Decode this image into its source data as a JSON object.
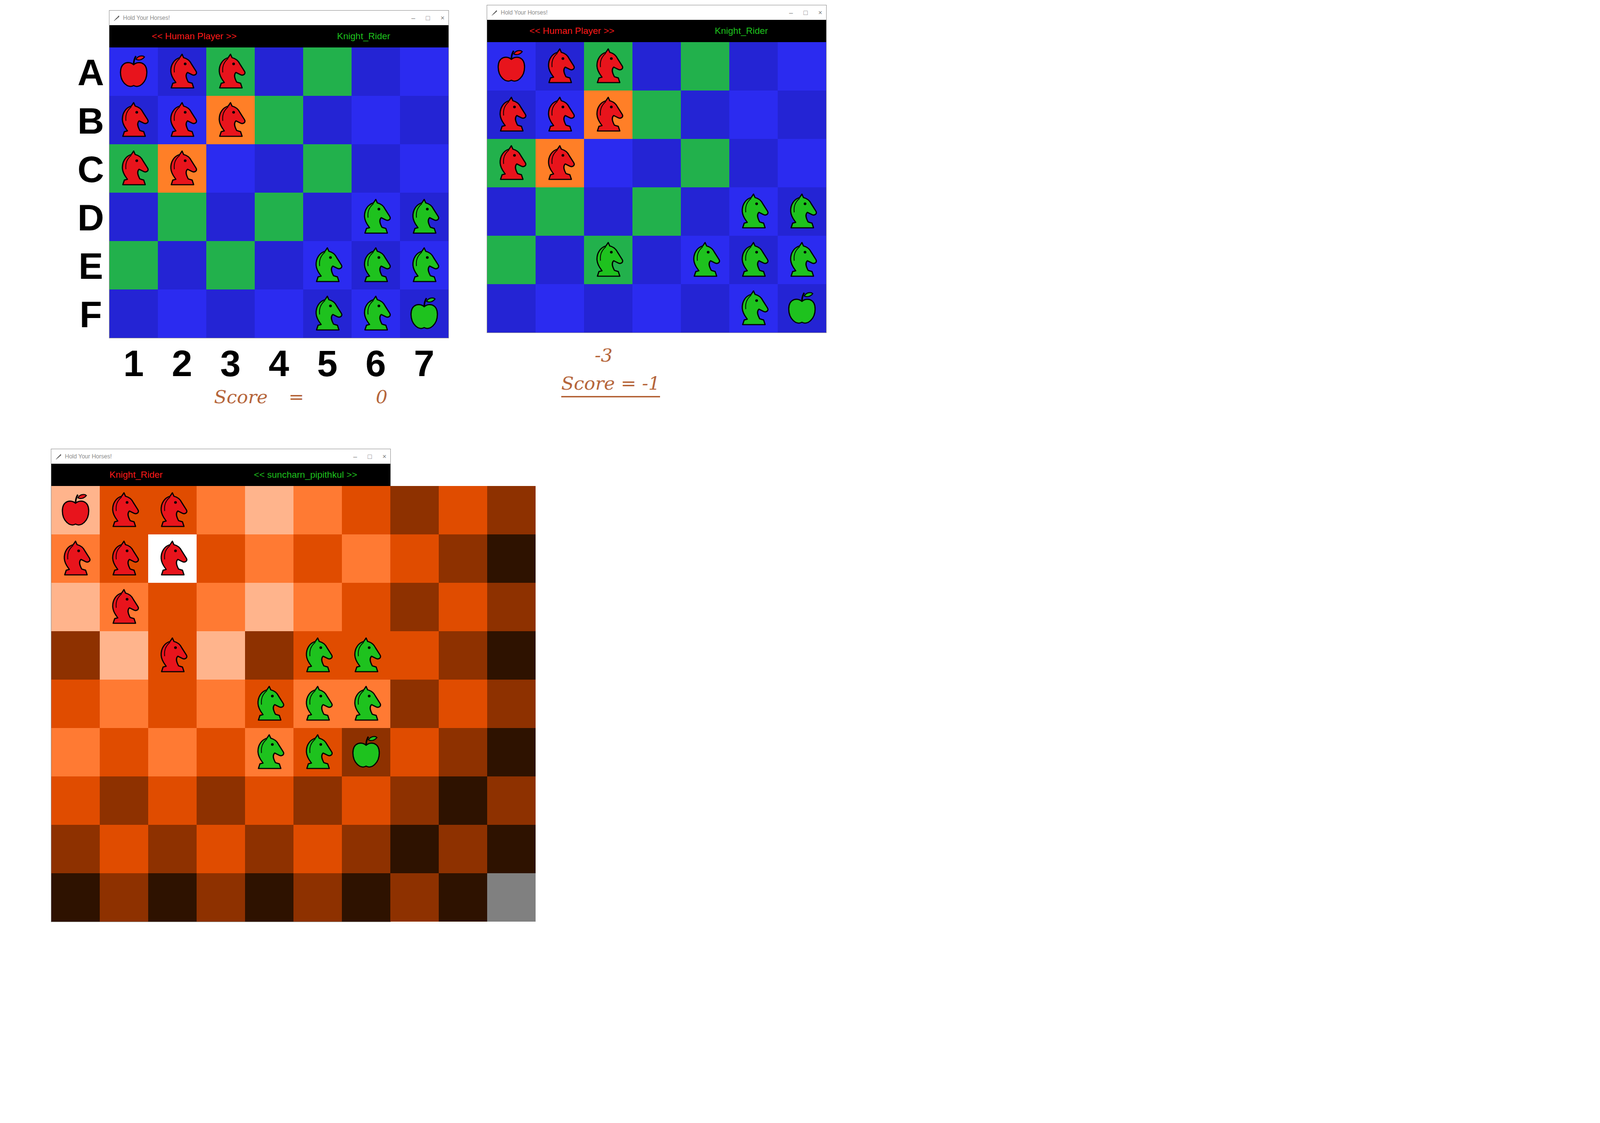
{
  "windows": [
    {
      "title": "Hold Your Horses!",
      "controls": [
        "–",
        "□",
        "×"
      ],
      "players": [
        {
          "name": "<< Human Player >>",
          "color": "#ff1a1a"
        },
        {
          "name": "Knight_Rider",
          "color": "#1ec21e"
        }
      ],
      "row_labels": [
        "A",
        "B",
        "C",
        "D",
        "E",
        "F"
      ],
      "col_labels": [
        "1",
        "2",
        "3",
        "4",
        "5",
        "6",
        "7"
      ],
      "board": [
        [
          {
            "color": "#2b2bf0",
            "kind": "apple",
            "side": "red"
          },
          {
            "color": "#2424d4",
            "kind": "knight",
            "side": "red"
          },
          {
            "color": "#22b14c",
            "kind": "knight",
            "side": "red"
          },
          {
            "color": "#2424d4",
            "kind": "empty"
          },
          {
            "color": "#22b14c",
            "kind": "empty"
          },
          {
            "color": "#2424d4",
            "kind": "empty"
          },
          {
            "color": "#2b2bf0",
            "kind": "empty"
          }
        ],
        [
          {
            "color": "#2424d4",
            "kind": "knight",
            "side": "red"
          },
          {
            "color": "#2b2bf0",
            "kind": "knight",
            "side": "red"
          },
          {
            "color": "#ff7f27",
            "kind": "knight",
            "side": "red"
          },
          {
            "color": "#22b14c",
            "kind": "empty"
          },
          {
            "color": "#2424d4",
            "kind": "empty"
          },
          {
            "color": "#2b2bf0",
            "kind": "empty"
          },
          {
            "color": "#2424d4",
            "kind": "empty"
          }
        ],
        [
          {
            "color": "#22b14c",
            "kind": "knight",
            "side": "red"
          },
          {
            "color": "#ff7f27",
            "kind": "knight",
            "side": "red"
          },
          {
            "color": "#2b2bf0",
            "kind": "empty"
          },
          {
            "color": "#2424d4",
            "kind": "empty"
          },
          {
            "color": "#22b14c",
            "kind": "empty"
          },
          {
            "color": "#2424d4",
            "kind": "empty"
          },
          {
            "color": "#2b2bf0",
            "kind": "empty"
          }
        ],
        [
          {
            "color": "#2424d4",
            "kind": "empty"
          },
          {
            "color": "#22b14c",
            "kind": "empty"
          },
          {
            "color": "#2424d4",
            "kind": "empty"
          },
          {
            "color": "#22b14c",
            "kind": "empty"
          },
          {
            "color": "#2424d4",
            "kind": "empty"
          },
          {
            "color": "#2b2bf0",
            "kind": "knight",
            "side": "green"
          },
          {
            "color": "#2424d4",
            "kind": "knight",
            "side": "green"
          }
        ],
        [
          {
            "color": "#22b14c",
            "kind": "empty"
          },
          {
            "color": "#2424d4",
            "kind": "empty"
          },
          {
            "color": "#22b14c",
            "kind": "empty"
          },
          {
            "color": "#2424d4",
            "kind": "empty"
          },
          {
            "color": "#2b2bf0",
            "kind": "knight",
            "side": "green"
          },
          {
            "color": "#2424d4",
            "kind": "knight",
            "side": "green"
          },
          {
            "color": "#2b2bf0",
            "kind": "knight",
            "side": "green"
          }
        ],
        [
          {
            "color": "#2424d4",
            "kind": "empty"
          },
          {
            "color": "#2b2bf0",
            "kind": "empty"
          },
          {
            "color": "#2424d4",
            "kind": "empty"
          },
          {
            "color": "#2b2bf0",
            "kind": "empty"
          },
          {
            "color": "#2424d4",
            "kind": "knight",
            "side": "green"
          },
          {
            "color": "#2b2bf0",
            "kind": "knight",
            "side": "green"
          },
          {
            "color": "#2424d4",
            "kind": "apple",
            "side": "green"
          }
        ]
      ]
    },
    {
      "title": "Hold Your Horses!",
      "controls": [
        "–",
        "□",
        "×"
      ],
      "players": [
        {
          "name": "<< Human Player >>",
          "color": "#ff1a1a"
        },
        {
          "name": "Knight_Rider",
          "color": "#1ec21e"
        }
      ],
      "board": [
        [
          {
            "color": "#2b2bf0",
            "kind": "apple",
            "side": "red"
          },
          {
            "color": "#2424d4",
            "kind": "knight",
            "side": "red"
          },
          {
            "color": "#22b14c",
            "kind": "knight",
            "side": "red"
          },
          {
            "color": "#2424d4",
            "kind": "empty"
          },
          {
            "color": "#22b14c",
            "kind": "empty"
          },
          {
            "color": "#2424d4",
            "kind": "empty"
          },
          {
            "color": "#2b2bf0",
            "kind": "empty"
          }
        ],
        [
          {
            "color": "#2424d4",
            "kind": "knight",
            "side": "red"
          },
          {
            "color": "#2b2bf0",
            "kind": "knight",
            "side": "red"
          },
          {
            "color": "#ff7f27",
            "kind": "knight",
            "side": "red"
          },
          {
            "color": "#22b14c",
            "kind": "empty"
          },
          {
            "color": "#2424d4",
            "kind": "empty"
          },
          {
            "color": "#2b2bf0",
            "kind": "empty"
          },
          {
            "color": "#2424d4",
            "kind": "empty"
          }
        ],
        [
          {
            "color": "#22b14c",
            "kind": "knight",
            "side": "red"
          },
          {
            "color": "#ff7f27",
            "kind": "knight",
            "side": "red"
          },
          {
            "color": "#2b2bf0",
            "kind": "empty"
          },
          {
            "color": "#2424d4",
            "kind": "empty"
          },
          {
            "color": "#22b14c",
            "kind": "empty"
          },
          {
            "color": "#2424d4",
            "kind": "empty"
          },
          {
            "color": "#2b2bf0",
            "kind": "empty"
          }
        ],
        [
          {
            "color": "#2424d4",
            "kind": "empty"
          },
          {
            "color": "#22b14c",
            "kind": "empty"
          },
          {
            "color": "#2424d4",
            "kind": "empty"
          },
          {
            "color": "#22b14c",
            "kind": "empty"
          },
          {
            "color": "#2424d4",
            "kind": "empty"
          },
          {
            "color": "#2b2bf0",
            "kind": "knight",
            "side": "green"
          },
          {
            "color": "#2424d4",
            "kind": "knight",
            "side": "green"
          }
        ],
        [
          {
            "color": "#22b14c",
            "kind": "empty"
          },
          {
            "color": "#2424d4",
            "kind": "empty"
          },
          {
            "color": "#22b14c",
            "kind": "knight",
            "side": "green"
          },
          {
            "color": "#2424d4",
            "kind": "empty"
          },
          {
            "color": "#2b2bf0",
            "kind": "knight",
            "side": "green"
          },
          {
            "color": "#2424d4",
            "kind": "knight",
            "side": "green"
          },
          {
            "color": "#2b2bf0",
            "kind": "knight",
            "side": "green"
          }
        ],
        [
          {
            "color": "#2424d4",
            "kind": "empty"
          },
          {
            "color": "#2b2bf0",
            "kind": "empty"
          },
          {
            "color": "#2424d4",
            "kind": "empty"
          },
          {
            "color": "#2b2bf0",
            "kind": "empty"
          },
          {
            "color": "#2424d4",
            "kind": "empty"
          },
          {
            "color": "#2b2bf0",
            "kind": "knight",
            "side": "green"
          },
          {
            "color": "#2424d4",
            "kind": "apple",
            "side": "green"
          }
        ]
      ]
    },
    {
      "title": "Hold Your Horses!",
      "controls": [
        "–",
        "□",
        "×"
      ],
      "players": [
        {
          "name": "Knight_Rider",
          "color": "#ff1a1a"
        },
        {
          "name": "<< suncharn_pipithkul >>",
          "color": "#1ec21e"
        }
      ],
      "board": [
        [
          {
            "color": "#ffb48c",
            "kind": "apple",
            "side": "red"
          },
          {
            "color": "#e04c00",
            "kind": "knight",
            "side": "red"
          },
          {
            "color": "#e04c00",
            "kind": "knight",
            "side": "red"
          },
          {
            "color": "#ff7a33",
            "kind": "empty"
          },
          {
            "color": "#ffb48c",
            "kind": "empty"
          },
          {
            "color": "#ff7a33",
            "kind": "empty"
          },
          {
            "color": "#e04c00",
            "kind": "empty"
          },
          {
            "color": "#8e3100",
            "kind": "empty"
          },
          {
            "color": "#e04c00",
            "kind": "empty"
          },
          {
            "color": "#8e3100",
            "kind": "empty"
          }
        ],
        [
          {
            "color": "#ff7a33",
            "kind": "knight",
            "side": "red"
          },
          {
            "color": "#e04c00",
            "kind": "knight",
            "side": "red"
          },
          {
            "color": "#ffffff",
            "kind": "knight",
            "side": "red"
          },
          {
            "color": "#e04c00",
            "kind": "empty"
          },
          {
            "color": "#ff7a33",
            "kind": "empty"
          },
          {
            "color": "#e04c00",
            "kind": "empty"
          },
          {
            "color": "#ff7a33",
            "kind": "empty"
          },
          {
            "color": "#e04c00",
            "kind": "empty"
          },
          {
            "color": "#8e3100",
            "kind": "empty"
          },
          {
            "color": "#2e1200",
            "kind": "empty"
          }
        ],
        [
          {
            "color": "#ffb48c",
            "kind": "empty"
          },
          {
            "color": "#ff7a33",
            "kind": "knight",
            "side": "red"
          },
          {
            "color": "#e04c00",
            "kind": "empty"
          },
          {
            "color": "#ff7a33",
            "kind": "empty"
          },
          {
            "color": "#ffb48c",
            "kind": "empty"
          },
          {
            "color": "#ff7a33",
            "kind": "empty"
          },
          {
            "color": "#e04c00",
            "kind": "empty"
          },
          {
            "color": "#8e3100",
            "kind": "empty"
          },
          {
            "color": "#e04c00",
            "kind": "empty"
          },
          {
            "color": "#8e3100",
            "kind": "empty"
          }
        ],
        [
          {
            "color": "#8e3100",
            "kind": "empty"
          },
          {
            "color": "#ffb48c",
            "kind": "empty"
          },
          {
            "color": "#e04c00",
            "kind": "knight",
            "side": "red"
          },
          {
            "color": "#ffb48c",
            "kind": "empty"
          },
          {
            "color": "#8e3100",
            "kind": "empty"
          },
          {
            "color": "#e04c00",
            "kind": "knight",
            "side": "green"
          },
          {
            "color": "#e04c00",
            "kind": "knight",
            "side": "green"
          },
          {
            "color": "#e04c00",
            "kind": "empty"
          },
          {
            "color": "#8e3100",
            "kind": "empty"
          },
          {
            "color": "#2e1200",
            "kind": "empty"
          }
        ],
        [
          {
            "color": "#e04c00",
            "kind": "empty"
          },
          {
            "color": "#ff7a33",
            "kind": "empty"
          },
          {
            "color": "#e04c00",
            "kind": "empty"
          },
          {
            "color": "#ff7a33",
            "kind": "empty"
          },
          {
            "color": "#e04c00",
            "kind": "knight",
            "side": "green"
          },
          {
            "color": "#ff7a33",
            "kind": "knight",
            "side": "green"
          },
          {
            "color": "#ff7a33",
            "kind": "knight",
            "side": "green"
          },
          {
            "color": "#8e3100",
            "kind": "empty"
          },
          {
            "color": "#e04c00",
            "kind": "empty"
          },
          {
            "color": "#8e3100",
            "kind": "empty"
          }
        ],
        [
          {
            "color": "#ff7a33",
            "kind": "empty"
          },
          {
            "color": "#e04c00",
            "kind": "empty"
          },
          {
            "color": "#ff7a33",
            "kind": "empty"
          },
          {
            "color": "#e04c00",
            "kind": "empty"
          },
          {
            "color": "#ff7a33",
            "kind": "knight",
            "side": "green"
          },
          {
            "color": "#e04c00",
            "kind": "knight",
            "side": "green"
          },
          {
            "color": "#8e3100",
            "kind": "apple",
            "side": "green"
          },
          {
            "color": "#e04c00",
            "kind": "empty"
          },
          {
            "color": "#8e3100",
            "kind": "empty"
          },
          {
            "color": "#2e1200",
            "kind": "empty"
          }
        ],
        [
          {
            "color": "#e04c00",
            "kind": "empty"
          },
          {
            "color": "#8e3100",
            "kind": "empty"
          },
          {
            "color": "#e04c00",
            "kind": "empty"
          },
          {
            "color": "#8e3100",
            "kind": "empty"
          },
          {
            "color": "#e04c00",
            "kind": "empty"
          },
          {
            "color": "#8e3100",
            "kind": "empty"
          },
          {
            "color": "#e04c00",
            "kind": "empty"
          },
          {
            "color": "#8e3100",
            "kind": "empty"
          },
          {
            "color": "#2e1200",
            "kind": "empty"
          },
          {
            "color": "#8e3100",
            "kind": "empty"
          }
        ],
        [
          {
            "color": "#8e3100",
            "kind": "empty"
          },
          {
            "color": "#e04c00",
            "kind": "empty"
          },
          {
            "color": "#8e3100",
            "kind": "empty"
          },
          {
            "color": "#e04c00",
            "kind": "empty"
          },
          {
            "color": "#8e3100",
            "kind": "empty"
          },
          {
            "color": "#e04c00",
            "kind": "empty"
          },
          {
            "color": "#8e3100",
            "kind": "empty"
          },
          {
            "color": "#2e1200",
            "kind": "empty"
          },
          {
            "color": "#8e3100",
            "kind": "empty"
          },
          {
            "color": "#2e1200",
            "kind": "empty"
          }
        ],
        [
          {
            "color": "#2e1200",
            "kind": "empty"
          },
          {
            "color": "#8e3100",
            "kind": "empty"
          },
          {
            "color": "#2e1200",
            "kind": "empty"
          },
          {
            "color": "#8e3100",
            "kind": "empty"
          },
          {
            "color": "#2e1200",
            "kind": "empty"
          },
          {
            "color": "#8e3100",
            "kind": "empty"
          },
          {
            "color": "#2e1200",
            "kind": "empty"
          },
          {
            "color": "#8e3100",
            "kind": "empty"
          },
          {
            "color": "#2e1200",
            "kind": "empty"
          },
          {
            "color": "#808080",
            "kind": "empty"
          }
        ]
      ]
    }
  ],
  "notes": [
    {
      "text": "Score",
      "underline": false
    },
    {
      "text": "=",
      "underline": false
    },
    {
      "text": "0",
      "underline": false
    },
    {
      "text": "-3",
      "underline": false
    },
    {
      "text": "Score = -1",
      "underline": true
    }
  ]
}
